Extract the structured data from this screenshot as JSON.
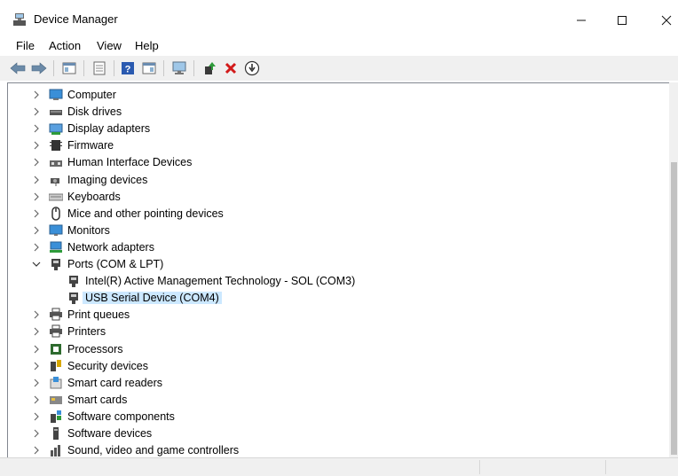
{
  "window": {
    "title": "Device Manager"
  },
  "menu": {
    "items": [
      "File",
      "Action",
      "View",
      "Help"
    ]
  },
  "tree": {
    "categories": [
      {
        "label": "Computer",
        "icon": "computer-icon"
      },
      {
        "label": "Disk drives",
        "icon": "disk-drive-icon"
      },
      {
        "label": "Display adapters",
        "icon": "display-adapter-icon"
      },
      {
        "label": "Firmware",
        "icon": "firmware-icon"
      },
      {
        "label": "Human Interface Devices",
        "icon": "hid-icon"
      },
      {
        "label": "Imaging devices",
        "icon": "camera-icon"
      },
      {
        "label": "Keyboards",
        "icon": "keyboard-icon"
      },
      {
        "label": "Mice and other pointing devices",
        "icon": "mouse-icon"
      },
      {
        "label": "Monitors",
        "icon": "monitor-icon"
      },
      {
        "label": "Network adapters",
        "icon": "network-adapter-icon"
      },
      {
        "label": "Ports (COM & LPT)",
        "icon": "port-icon"
      },
      {
        "label": "Intel(R) Active Management Technology - SOL (COM3)",
        "icon": "port-icon"
      },
      {
        "label": "USB Serial Device (COM4)",
        "icon": "port-icon"
      },
      {
        "label": "Print queues",
        "icon": "printer-icon"
      },
      {
        "label": "Printers",
        "icon": "printer-icon"
      },
      {
        "label": "Processors",
        "icon": "processor-icon"
      },
      {
        "label": "Security devices",
        "icon": "security-icon"
      },
      {
        "label": "Smart card readers",
        "icon": "smart-card-reader-icon"
      },
      {
        "label": "Smart cards",
        "icon": "smart-card-icon"
      },
      {
        "label": "Software components",
        "icon": "software-component-icon"
      },
      {
        "label": "Software devices",
        "icon": "software-device-icon"
      },
      {
        "label": "Sound, video and game controllers",
        "icon": "sound-icon"
      }
    ],
    "expanded": "Ports (COM & LPT)",
    "selected": "USB Serial Device (COM4)"
  },
  "colors": {
    "selection": "#cce8ff",
    "toolbar_bg": "#f0f0f0"
  }
}
